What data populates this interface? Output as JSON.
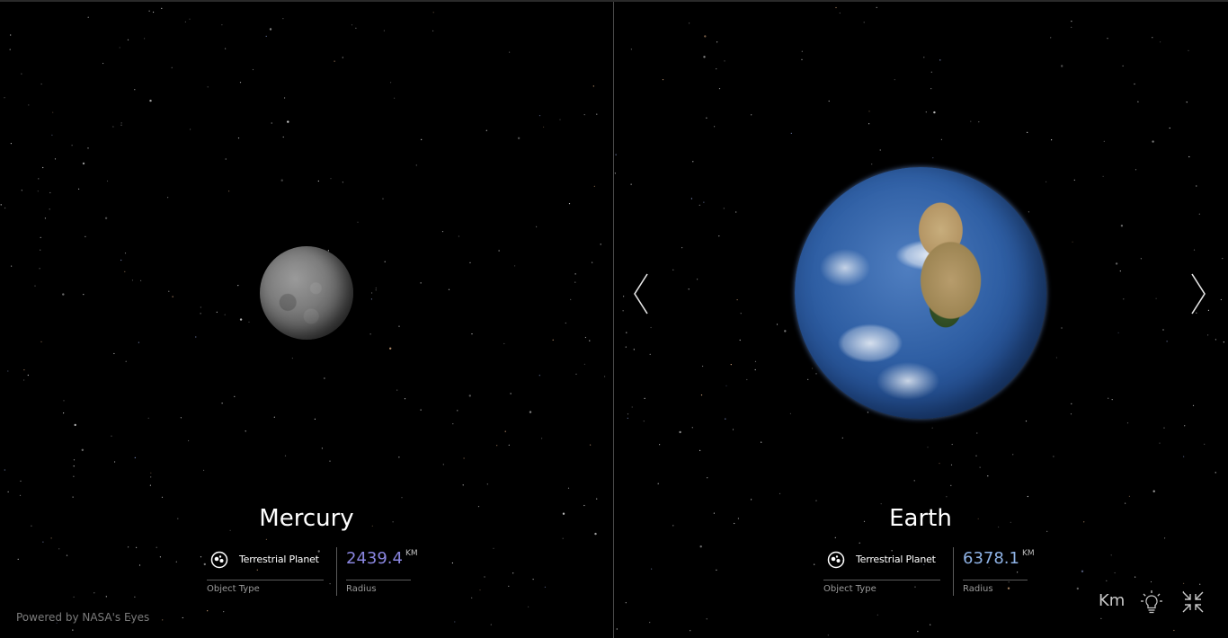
{
  "panels": {
    "left": {
      "planet_name": "Mercury",
      "planet_icon": "mercury-globe",
      "object_type": "Terrestrial Planet",
      "object_type_caption": "Object Type",
      "radius_value": "2439.4",
      "radius_unit": "KM",
      "radius_caption": "Radius",
      "type_icon": "terrestrial-planet-icon"
    },
    "right": {
      "planet_name": "Earth",
      "planet_icon": "earth-globe",
      "object_type": "Terrestrial Planet",
      "object_type_caption": "Object Type",
      "radius_value": "6378.1",
      "radius_unit": "KM",
      "radius_caption": "Radius",
      "type_icon": "terrestrial-planet-icon"
    }
  },
  "navigation": {
    "prev_icon": "chevron-left-icon",
    "next_icon": "chevron-right-icon"
  },
  "footer": {
    "powered_by": "Powered by NASA's Eyes"
  },
  "controls": {
    "unit_label": "Km",
    "light_icon": "lightbulb-icon",
    "collapse_icon": "collapse-icon"
  },
  "colors": {
    "background": "#000000",
    "mercury_radius": "#8a86e0",
    "earth_radius": "#8fb3e6",
    "divider": "#4a4a4a"
  }
}
